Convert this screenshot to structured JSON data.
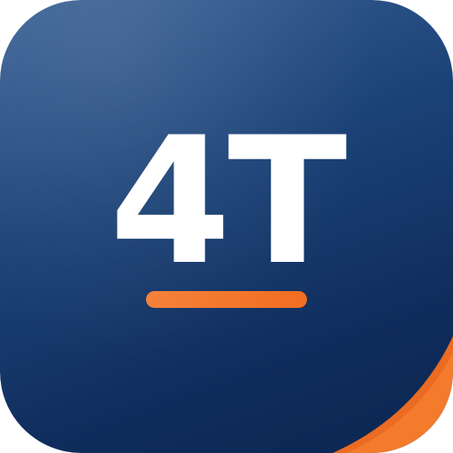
{
  "logo": {
    "monogram": "4T",
    "colors": {
      "background_top": "#3b6296",
      "background_bottom": "#0b2550",
      "text": "#ffffff",
      "accent": "#f26d21"
    },
    "accent_shapes": [
      "underline-bar",
      "corner-fold"
    ]
  }
}
